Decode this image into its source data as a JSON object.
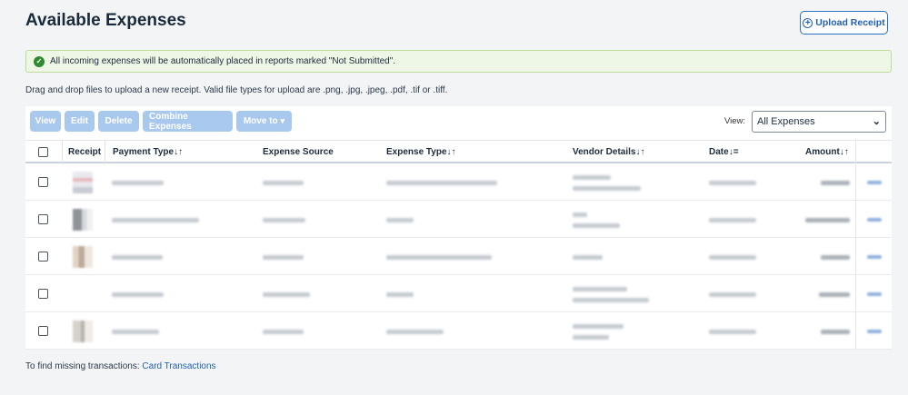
{
  "page": {
    "title": "Available Expenses",
    "upload_button": "Upload Receipt"
  },
  "alert": {
    "message": "All incoming expenses will be automatically placed in reports marked \"Not Submitted\"."
  },
  "hint": "Drag and drop files to upload a new receipt. Valid file types for upload are .png, .jpg, .jpeg, .pdf, .tif or .tiff.",
  "toolbar": {
    "view": "View",
    "edit": "Edit",
    "delete": "Delete",
    "combine": "Combine Expenses",
    "move_to": "Move to"
  },
  "view_filter": {
    "label": "View:",
    "selected": "All Expenses"
  },
  "table": {
    "columns": {
      "receipt": "Receipt",
      "payment_type": "Payment Type",
      "expense_source": "Expense Source",
      "expense_type": "Expense Type",
      "vendor_details": "Vendor Details",
      "date": "Date",
      "amount": "Amount"
    },
    "sort_icons": {
      "payment_type": "↓↑",
      "expense_type": "↓↑",
      "vendor_details": "↓↑",
      "date": "↓=",
      "amount": "↓↑"
    }
  },
  "footer": {
    "text": "To find missing transactions:",
    "link": "Card Transactions"
  },
  "colors": {
    "accent": "#1f5fb4",
    "disabled_button": "#a9c8ee",
    "success": "#2f8a2f"
  }
}
